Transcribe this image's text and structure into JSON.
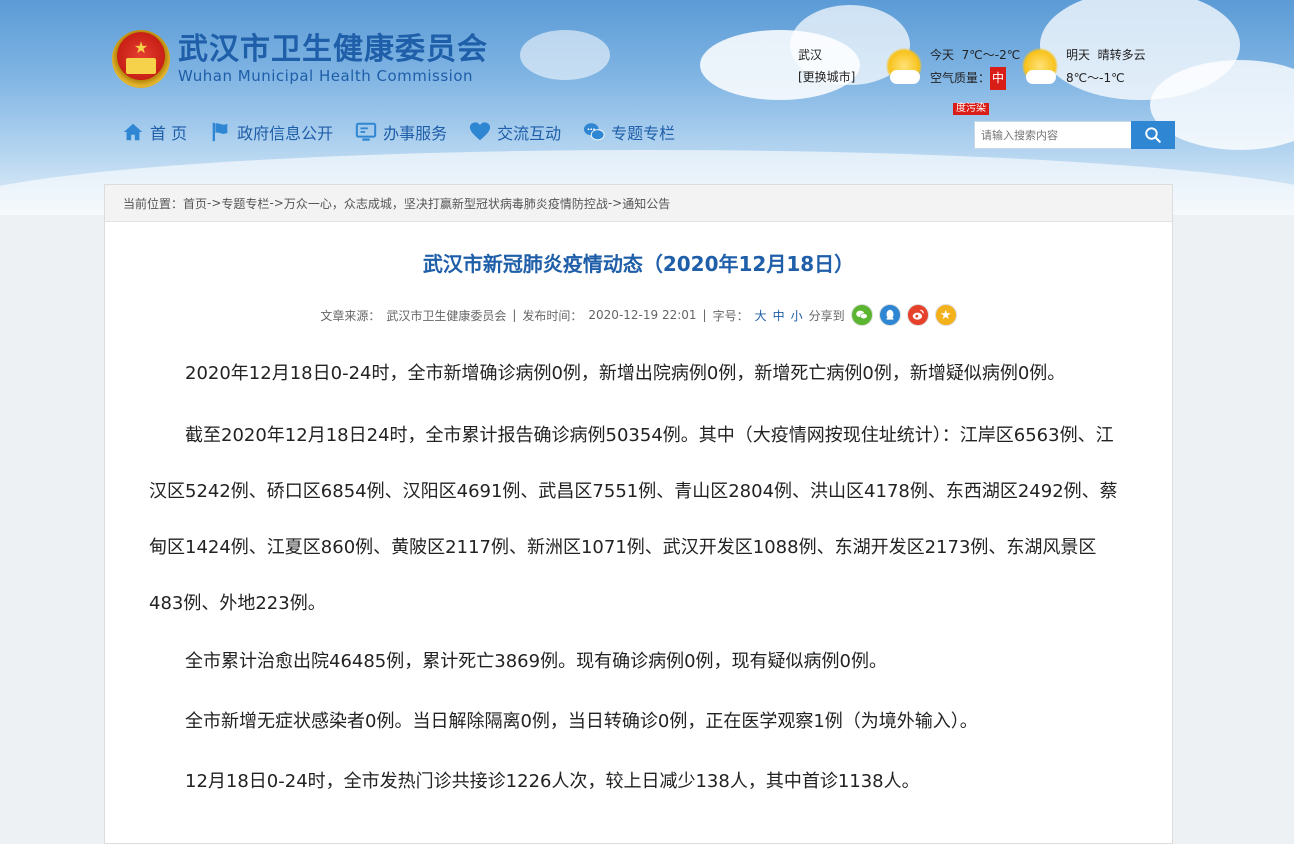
{
  "site": {
    "name_cn": "武汉市卫生健康委员会",
    "name_en": "Wuhan Municipal Health Commission"
  },
  "weather": {
    "city": "武汉",
    "change_city": "[更换城市]",
    "today": {
      "label": "今天",
      "temp": "7℃～-2℃",
      "air_label": "空气质量：",
      "air_value": "中",
      "air_tip": "度污染"
    },
    "tomorrow": {
      "label": "明天",
      "desc": "晴转多云",
      "temp": "8℃～-1℃"
    }
  },
  "nav": [
    {
      "label": "首 页",
      "icon": "home-icon"
    },
    {
      "label": "政府信息公开",
      "icon": "flag-icon"
    },
    {
      "label": "办事服务",
      "icon": "monitor-icon"
    },
    {
      "label": "交流互动",
      "icon": "heart-icon"
    },
    {
      "label": "专题专栏",
      "icon": "chat-icon"
    }
  ],
  "search": {
    "placeholder": "请输入搜索内容"
  },
  "breadcrumb": {
    "prefix": "当前位置：",
    "items": [
      "首页",
      "专题专栏",
      "万众一心，众志成城，坚决打赢新型冠状病毒肺炎疫情防控战",
      "通知公告"
    ],
    "sep": "->"
  },
  "article": {
    "title": "武汉市新冠肺炎疫情动态（2020年12月18日）",
    "meta": {
      "source_label": "文章来源：",
      "source": "武汉市卫生健康委员会",
      "sep": "|",
      "time_label": "发布时间：",
      "time": "2020-12-19 22:01",
      "size_label": "字号：",
      "size_large": "大",
      "size_mid": "中",
      "size_small": "小",
      "share_label": "分享到"
    },
    "paragraphs": [
      "2020年12月18日0-24时，全市新增确诊病例0例，新增出院病例0例，新增死亡病例0例，新增疑似病例0例。",
      "截至2020年12月18日24时，全市累计报告确诊病例50354例。其中（大疫情网按现住址统计）：江岸区6563例、江汉区5242例、硚口区6854例、汉阳区4691例、武昌区7551例、青山区2804例、洪山区4178例、东西湖区2492例、蔡甸区1424例、江夏区860例、黄陂区2117例、新洲区1071例、武汉开发区1088例、东湖开发区2173例、东湖风景区483例、外地223例。",
      "全市累计治愈出院46485例，累计死亡3869例。现有确诊病例0例，现有疑似病例0例。",
      "全市新增无症状感染者0例。当日解除隔离0例，当日转确诊0例，正在医学观察1例（为境外输入）。",
      "12月18日0-24时，全市发热门诊共接诊1226人次，较上日减少138人，其中首诊1138人。"
    ]
  },
  "colors": {
    "brand": "#1f5ea8",
    "accent": "#2f86d2",
    "alert": "#d91e18"
  }
}
